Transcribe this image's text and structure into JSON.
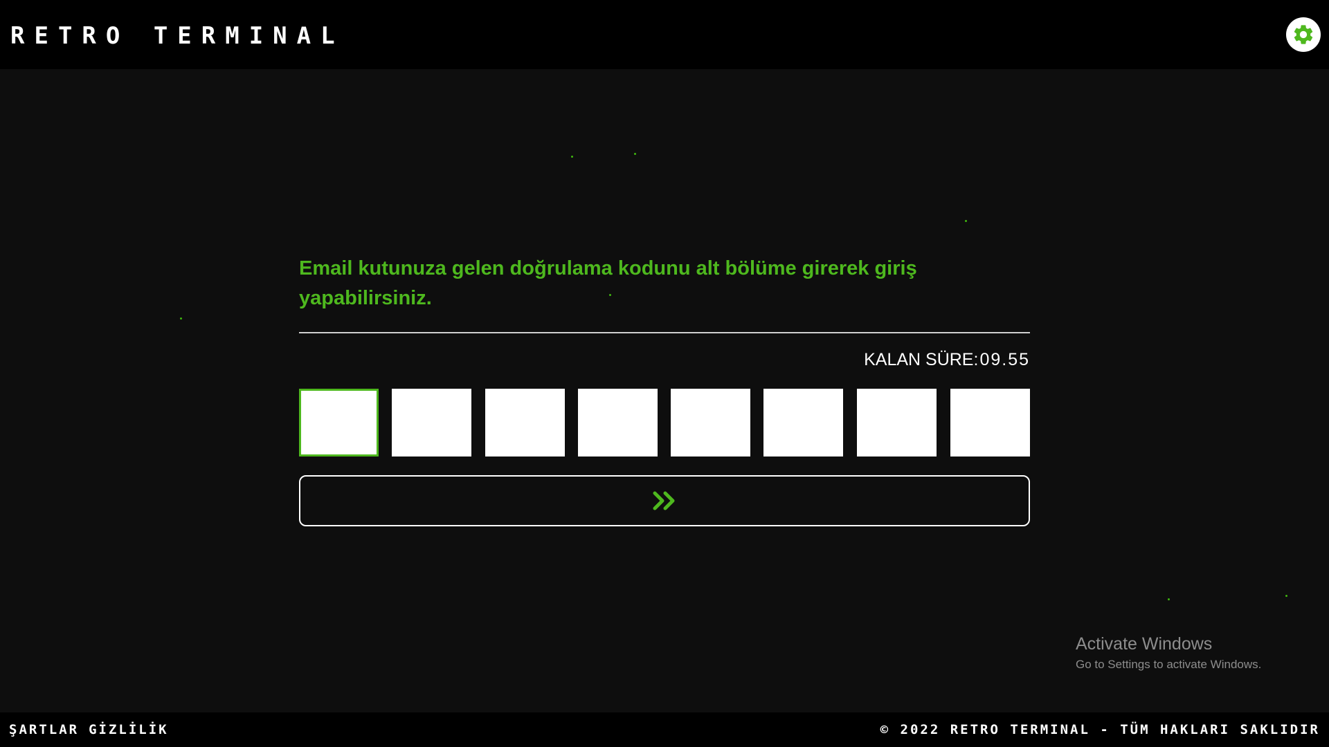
{
  "header": {
    "brand": "RETRO TERMINAL",
    "settings_icon": "gear-icon"
  },
  "verification": {
    "message": "Email kutunuza gelen doğrulama kodunu alt bölüme girerek giriş yapabilirsiniz.",
    "timer_label": "KALAN SÜRE:",
    "timer_value": "09.55",
    "code_length": 8,
    "code_values": [
      "",
      "",
      "",
      "",
      "",
      "",
      "",
      ""
    ],
    "submit_icon": "double-chevron-right-icon"
  },
  "watermark": {
    "title": "Activate Windows",
    "subtitle": "Go to Settings to activate Windows."
  },
  "footer": {
    "links": [
      "ŞARTLAR",
      "GİZLİLİK"
    ],
    "copyright": "© 2022 RETRO TERMINAL - TÜM HAKLARI SAKLIDIR"
  },
  "colors": {
    "accent": "#4eb81e",
    "header_bg": "#000000",
    "page_bg": "#0e0e0e",
    "text": "#ffffff"
  }
}
